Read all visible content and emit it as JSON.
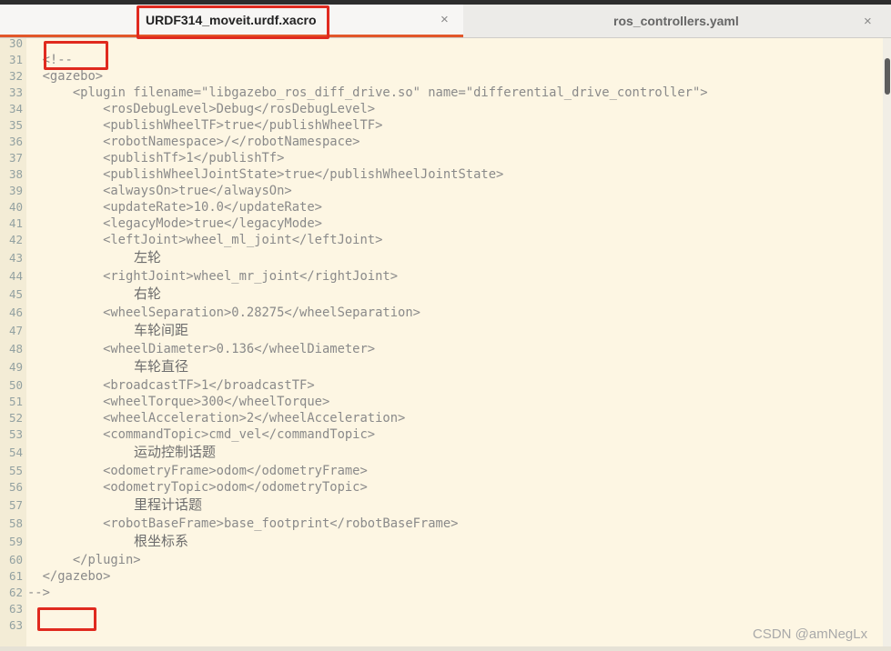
{
  "tabs": [
    {
      "label": "URDF314_moveit.urdf.xacro",
      "close": "×",
      "active": true
    },
    {
      "label": "ros_controllers.yaml",
      "close": "×",
      "active": false
    }
  ],
  "lines": [
    {
      "n": "30",
      "text": ""
    },
    {
      "n": "31",
      "text": "  <!--"
    },
    {
      "n": "32",
      "text": "  <gazebo>"
    },
    {
      "n": "33",
      "text": "      <plugin filename=\"libgazebo_ros_diff_drive.so\" name=\"differential_drive_controller\">"
    },
    {
      "n": "34",
      "text": "          <rosDebugLevel>Debug</rosDebugLevel>"
    },
    {
      "n": "35",
      "text": "          <publishWheelTF>true</publishWheelTF>"
    },
    {
      "n": "36",
      "text": "          <robotNamespace>/</robotNamespace>"
    },
    {
      "n": "37",
      "text": "          <publishTf>1</publishTf>"
    },
    {
      "n": "38",
      "text": "          <publishWheelJointState>true</publishWheelJointState>"
    },
    {
      "n": "39",
      "text": "          <alwaysOn>true</alwaysOn>"
    },
    {
      "n": "40",
      "text": "          <updateRate>10.0</updateRate>"
    },
    {
      "n": "41",
      "text": "          <legacyMode>true</legacyMode>"
    },
    {
      "n": "42",
      "text": "          <leftJoint>wheel_ml_joint</leftJoint>"
    },
    {
      "n": "43",
      "text": "左轮",
      "cjk": true
    },
    {
      "n": "44",
      "text": "          <rightJoint>wheel_mr_joint</rightJoint>"
    },
    {
      "n": "45",
      "text": "右轮",
      "cjk": true
    },
    {
      "n": "46",
      "text": "          <wheelSeparation>0.28275</wheelSeparation>"
    },
    {
      "n": "47",
      "text": "车轮间距",
      "cjk": true
    },
    {
      "n": "48",
      "text": "          <wheelDiameter>0.136</wheelDiameter>"
    },
    {
      "n": "49",
      "text": "车轮直径",
      "cjk": true
    },
    {
      "n": "50",
      "text": "          <broadcastTF>1</broadcastTF>"
    },
    {
      "n": "51",
      "text": "          <wheelTorque>300</wheelTorque>"
    },
    {
      "n": "52",
      "text": "          <wheelAcceleration>2</wheelAcceleration>"
    },
    {
      "n": "53",
      "text": "          <commandTopic>cmd_vel</commandTopic>"
    },
    {
      "n": "54",
      "text": "运动控制话题",
      "cjk": true
    },
    {
      "n": "55",
      "text": "          <odometryFrame>odom</odometryFrame>"
    },
    {
      "n": "56",
      "text": "          <odometryTopic>odom</odometryTopic>"
    },
    {
      "n": "57",
      "text": "里程计话题",
      "cjk": true
    },
    {
      "n": "58",
      "text": "          <robotBaseFrame>base_footprint</robotBaseFrame>"
    },
    {
      "n": "59",
      "text": "根坐标系",
      "cjk": true
    },
    {
      "n": "60",
      "text": "      </plugin>"
    },
    {
      "n": "61",
      "text": "  </gazebo>"
    },
    {
      "n": "62",
      "text": "-->"
    },
    {
      "n": "63",
      "text": ""
    },
    {
      "n": "63",
      "text": ""
    }
  ],
  "watermark": "CSDN @amNegLx",
  "colors": {
    "highlight": "#e02a1f",
    "tab_accent": "#e2572a",
    "editor_bg": "#fdf6e3"
  }
}
